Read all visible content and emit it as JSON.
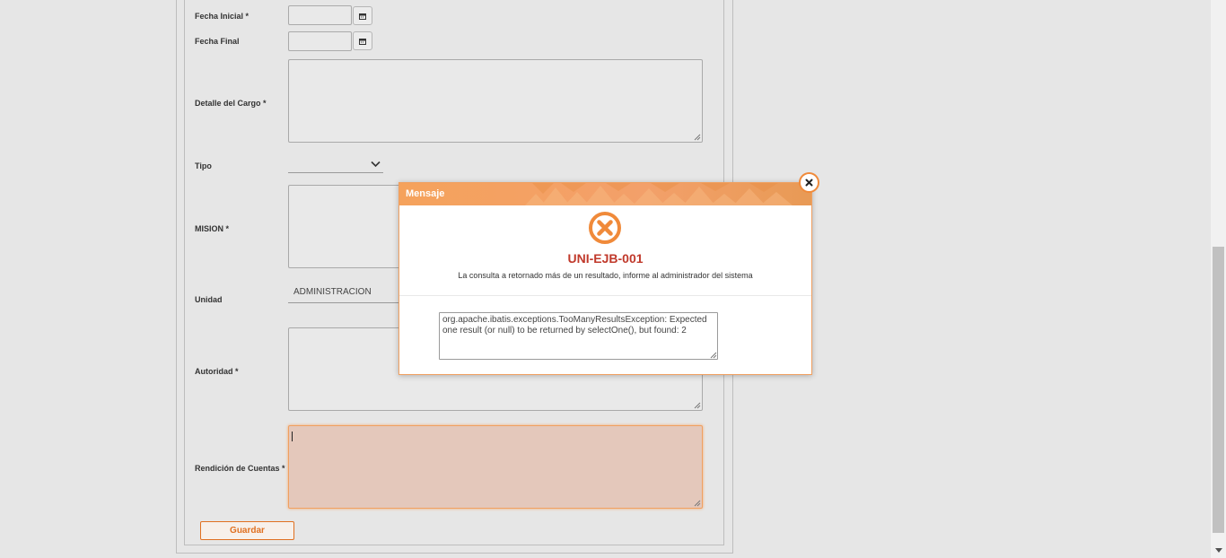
{
  "form": {
    "fecha_inicial_label": "Fecha Inicial *",
    "fecha_final_label": "Fecha Final",
    "detalle_label": "Detalle del Cargo *",
    "tipo_label": "Tipo",
    "mision_label": "MISION *",
    "unidad_label": "Unidad",
    "unidad_value": "ADMINISTRACION",
    "autoridad_label": "Autoridad *",
    "rendicion_label": "Rendición de Cuentas *",
    "save_label": "Guardar"
  },
  "modal": {
    "title": "Mensaje",
    "error_code": "UNI-EJB-001",
    "message": "La consulta a retornado más de un resultado, informe al administrador del sistema",
    "detail": "org.apache.ibatis.exceptions.TooManyResultsException: Expected one result (or null) to be returned by selectOne(), but found: 2"
  },
  "colors": {
    "accent": "#f08a3a",
    "error": "#c0392b",
    "header": "#f5a25c"
  }
}
